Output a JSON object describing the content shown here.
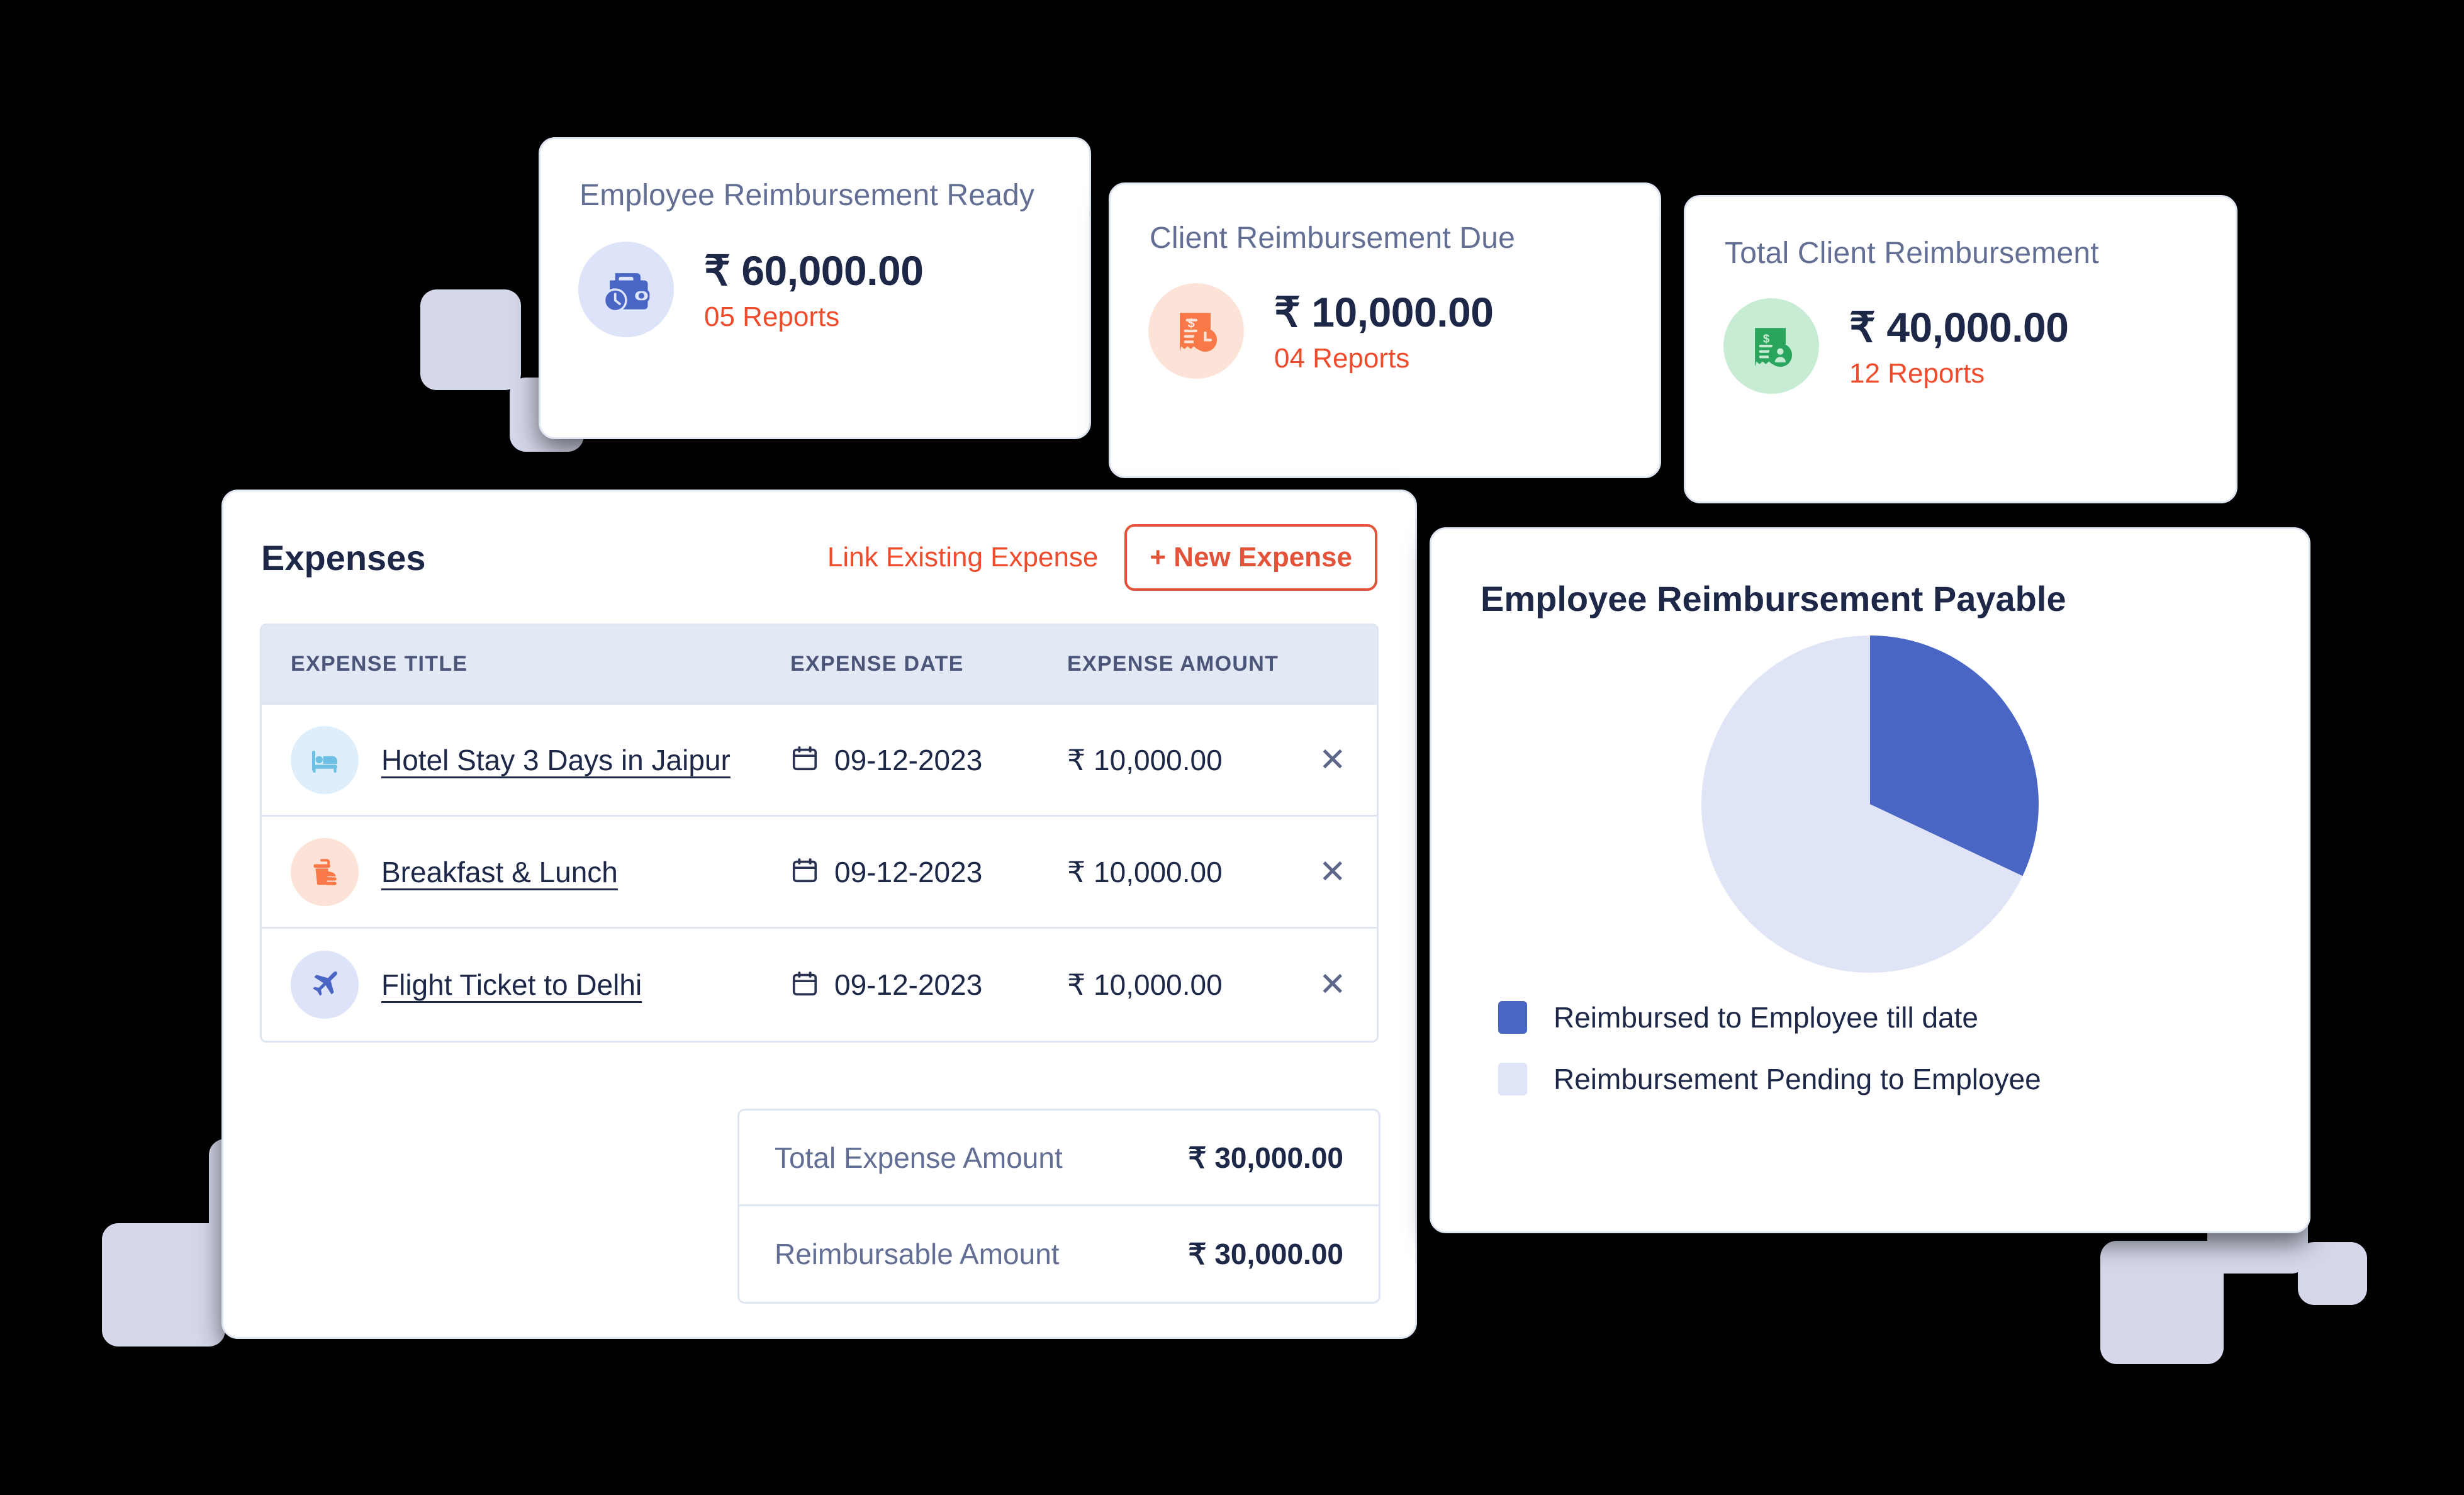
{
  "theme": {
    "accent_red": "#ef4b2d",
    "text_dark": "#1d2748",
    "text_muted": "#626e94",
    "card_border": "#dfe5f2",
    "deco_block": "#d4d8ea",
    "pie_blue": "#4a66c4",
    "pie_light": "#dfe4f7",
    "badge_blue_bg": "#dde3f8",
    "badge_orange_bg": "#fde3d7",
    "badge_green_bg": "#c8ebd3",
    "icon_blue": "#4a66c4",
    "icon_orange": "#f97847",
    "icon_green": "#2aa55e",
    "row_icon_hotel_bg": "#deeefa",
    "row_icon_hotel_fg": "#6ec0e4",
    "row_icon_food_bg": "#fde3d7",
    "row_icon_food_fg": "#f97847",
    "row_icon_flight_bg": "#dde3f8",
    "row_icon_flight_fg": "#4a66c4"
  },
  "kpi_cards": [
    {
      "title": "Employee Reimbursement Ready",
      "amount": "₹ 60,000.00",
      "reports": "05 Reports",
      "icon": "wallet-clock-icon"
    },
    {
      "title": "Client Reimbursement Due",
      "amount": "₹ 10,000.00",
      "reports": "04 Reports",
      "icon": "receipt-clock-icon"
    },
    {
      "title": "Total Client Reimbursement",
      "amount": "₹ 40,000.00",
      "reports": "12 Reports",
      "icon": "receipt-person-icon"
    }
  ],
  "expenses": {
    "heading": "Expenses",
    "link_existing_label": "Link Existing Expense",
    "new_expense_label": "+ New Expense",
    "columns": [
      "EXPENSE TITLE",
      "EXPENSE DATE",
      "EXPENSE AMOUNT"
    ],
    "rows": [
      {
        "icon": "bed-icon",
        "title": "Hotel Stay 3 Days in Jaipur",
        "date": "09-12-2023",
        "amount": "₹ 10,000.00",
        "remove": "✕"
      },
      {
        "icon": "food-drink-icon",
        "title": "Breakfast & Lunch",
        "date": "09-12-2023",
        "amount": "₹ 10,000.00",
        "remove": "✕"
      },
      {
        "icon": "airplane-icon",
        "title": "Flight Ticket to Delhi",
        "date": "09-12-2023",
        "amount": "₹ 10,000.00",
        "remove": "✕"
      }
    ],
    "totals": [
      {
        "label": "Total Expense Amount",
        "value": "₹ 30,000.00"
      },
      {
        "label": "Reimbursable Amount",
        "value": "₹ 30,000.00"
      }
    ]
  },
  "pie_panel": {
    "title": "Employee Reimbursement Payable"
  },
  "chart_data": {
    "type": "pie",
    "title": "Employee Reimbursement Payable",
    "categories": [
      "Reimbursed to Employee till date",
      "Reimbursement Pending to Employee"
    ],
    "values": [
      32,
      68
    ],
    "colors": [
      "#4a66c4",
      "#dfe4f7"
    ],
    "start_angle_deg": 0,
    "direction": "clockwise",
    "legend_position": "bottom-left",
    "grid": false,
    "labels_shown": false
  }
}
